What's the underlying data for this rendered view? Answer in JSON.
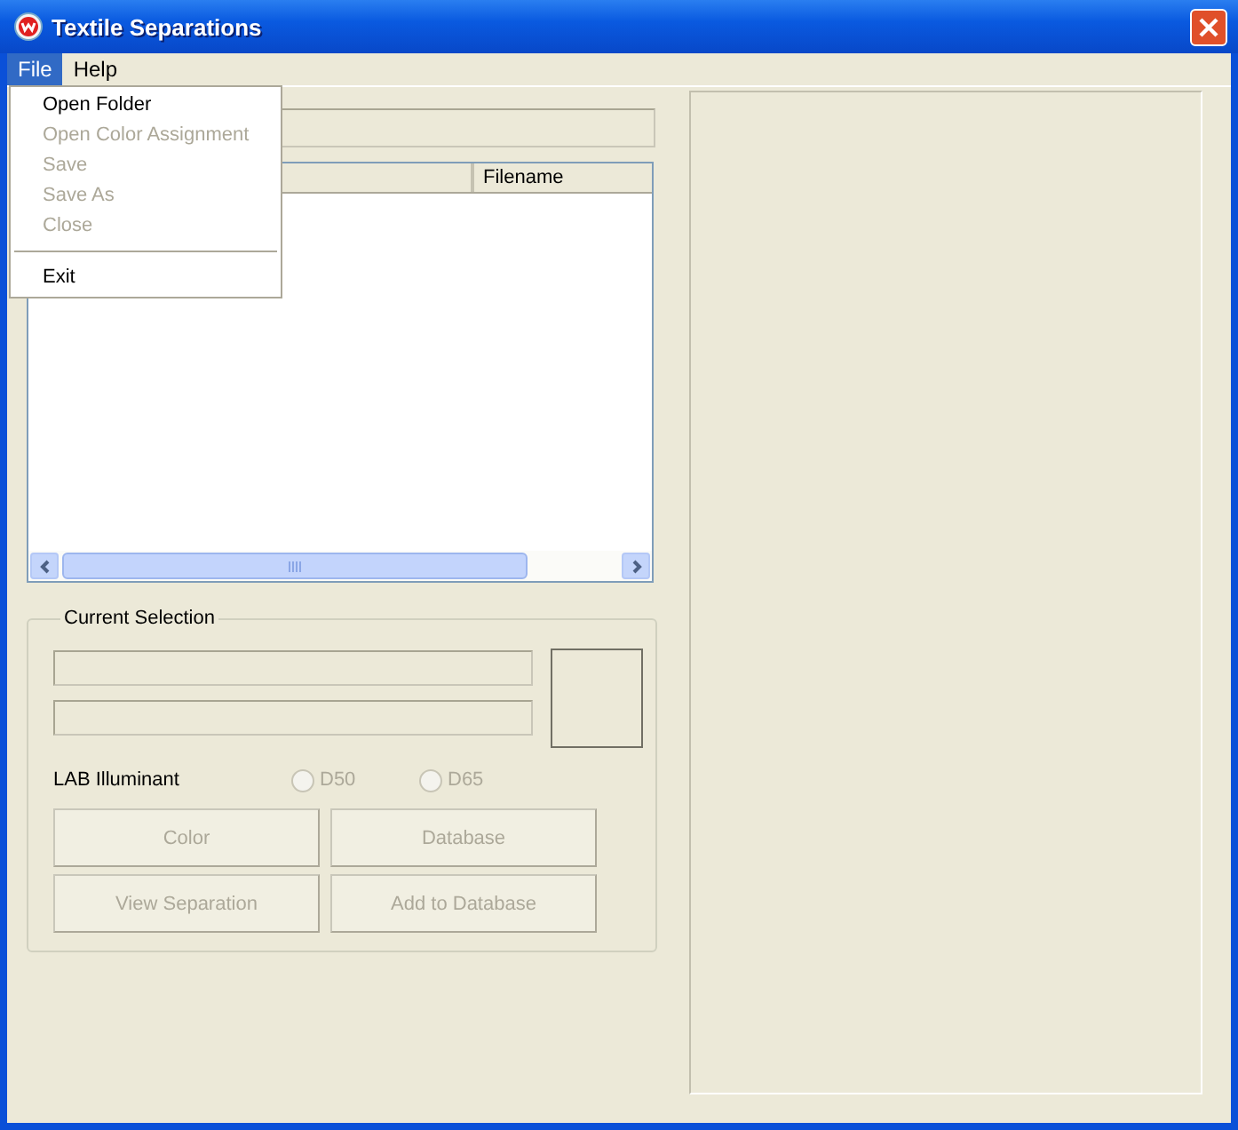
{
  "window": {
    "title": "Textile Separations"
  },
  "menu_bar": [
    {
      "label": "File",
      "selected": true
    },
    {
      "label": "Help",
      "selected": false
    }
  ],
  "file_menu": [
    {
      "kind": "item",
      "label": "Open Folder",
      "disabled": false
    },
    {
      "kind": "item",
      "label": "Open Color Assignment",
      "disabled": true
    },
    {
      "kind": "item",
      "label": "Save",
      "disabled": true
    },
    {
      "kind": "item",
      "label": "Save As",
      "disabled": true
    },
    {
      "kind": "item",
      "label": "Close",
      "disabled": true
    },
    {
      "kind": "separator"
    },
    {
      "kind": "item",
      "label": "Exit",
      "disabled": false
    }
  ],
  "file_list": {
    "columns": [
      "Filename"
    ]
  },
  "current_selection": {
    "title": "Current Selection",
    "illuminant_label": "LAB Illuminant",
    "illuminants": [
      {
        "label": "D50",
        "selected": false,
        "disabled": true
      },
      {
        "label": "D65",
        "selected": false,
        "disabled": true
      }
    ],
    "buttons": [
      {
        "label": "Color",
        "disabled": true
      },
      {
        "label": "Database",
        "disabled": true
      },
      {
        "label": "View Separation",
        "disabled": true
      },
      {
        "label": "Add to Database",
        "disabled": true
      }
    ]
  }
}
